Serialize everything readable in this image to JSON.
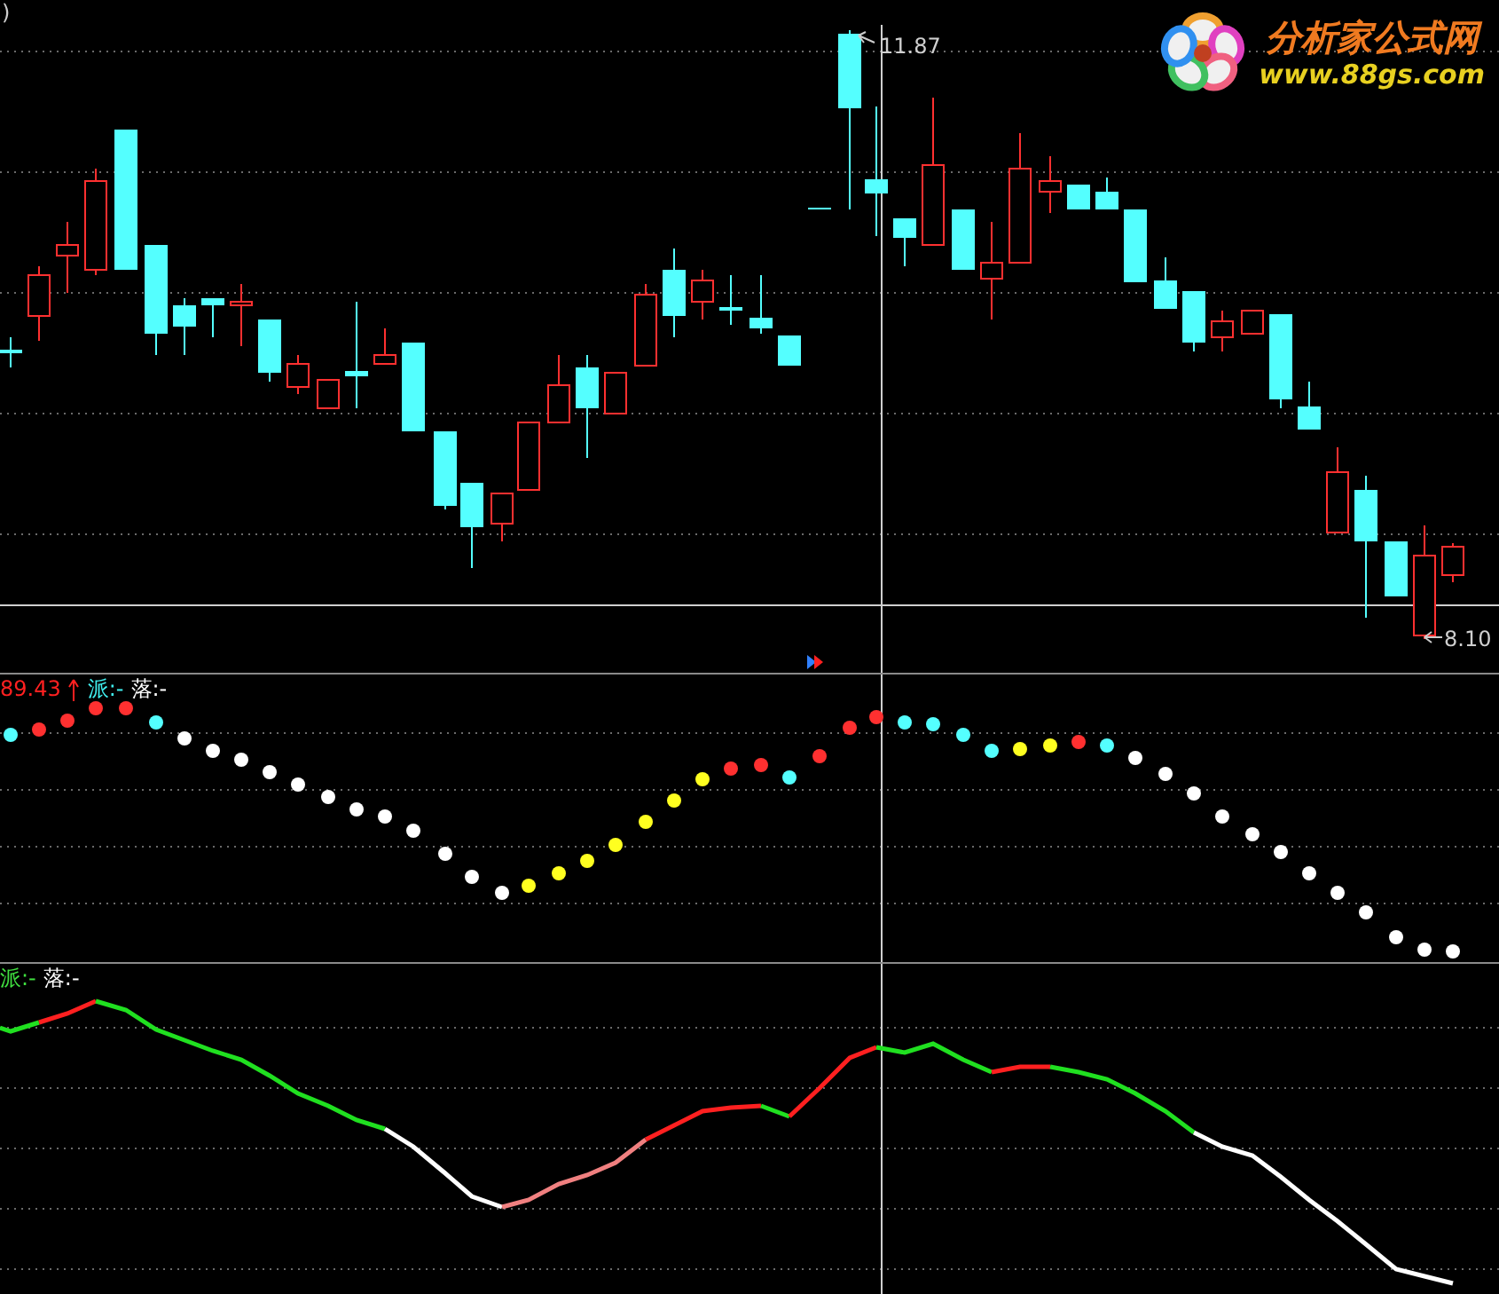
{
  "price_panel": {
    "corner_mark": ")",
    "high_price": "11.87",
    "low_price": "8.10"
  },
  "logo": {
    "title": "分析家公式网",
    "url": "www.88gs.com"
  },
  "dot_panel": {
    "value": "89.43",
    "legend": [
      {
        "name": "派:",
        "value": "-",
        "color": "#40f0f0"
      },
      {
        "name": "落:",
        "value": "-",
        "color": "#ffffff"
      }
    ]
  },
  "line_panel": {
    "legend": [
      {
        "name": "派:",
        "value": "-",
        "color": "#40e040"
      },
      {
        "name": "落:",
        "value": "-",
        "color": "#ffffff"
      }
    ]
  }
}
